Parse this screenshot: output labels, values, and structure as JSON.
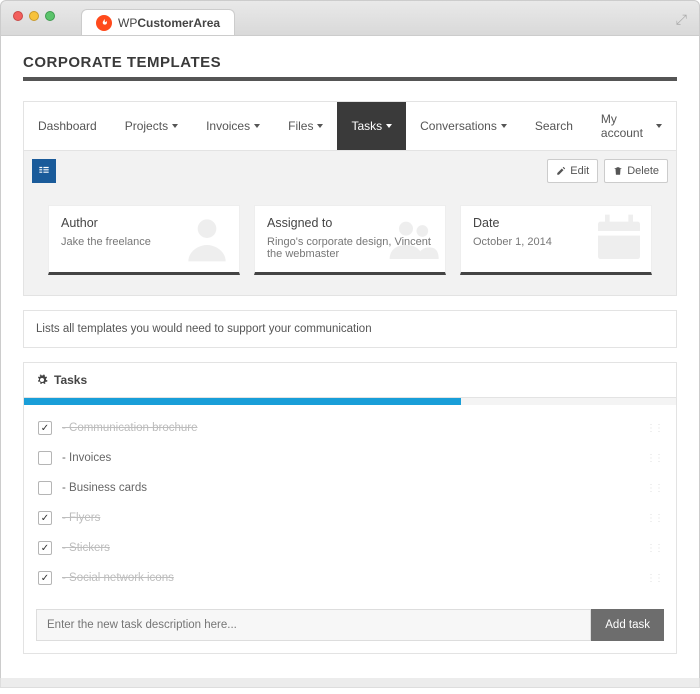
{
  "browser": {
    "tab_title_prefix": "WP",
    "tab_title_bold": "CustomerArea"
  },
  "page_title": "Corporate templates",
  "menu": {
    "items": [
      {
        "label": "Dashboard",
        "caret": false
      },
      {
        "label": "Projects",
        "caret": true
      },
      {
        "label": "Invoices",
        "caret": true
      },
      {
        "label": "Files",
        "caret": true
      },
      {
        "label": "Tasks",
        "caret": true,
        "active": true
      },
      {
        "label": "Conversations",
        "caret": true
      },
      {
        "label": "Search",
        "caret": false
      },
      {
        "label": "My account",
        "caret": true
      }
    ]
  },
  "toolbar": {
    "edit_label": "Edit",
    "delete_label": "Delete"
  },
  "meta": {
    "author": {
      "label": "Author",
      "value": "Jake the freelance"
    },
    "assigned": {
      "label": "Assigned to",
      "value": "Ringo's corporate design, Vincent the webmaster"
    },
    "date": {
      "label": "Date",
      "value": "October 1, 2014"
    }
  },
  "description": "Lists all templates you would need to support your communication",
  "tasks": {
    "heading": "Tasks",
    "progress_percent": 67,
    "items": [
      {
        "label": "- Communication brochure",
        "done": true
      },
      {
        "label": "- Invoices",
        "done": false
      },
      {
        "label": "- Business cards",
        "done": false
      },
      {
        "label": "- Flyers",
        "done": true
      },
      {
        "label": "- Stickers",
        "done": true
      },
      {
        "label": "- Social network icons",
        "done": true
      }
    ],
    "add_placeholder": "Enter the new task description here...",
    "add_button": "Add task"
  }
}
